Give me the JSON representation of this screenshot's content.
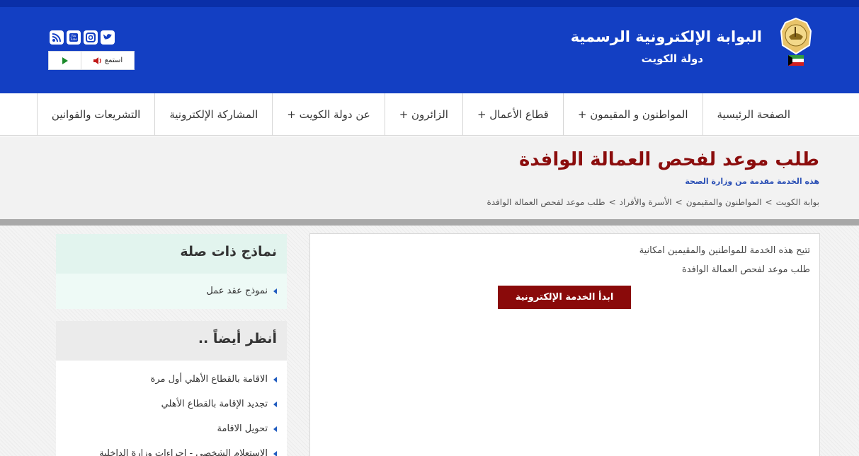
{
  "header": {
    "title": "البوابة الإلكترونية الرسمية",
    "subtitle": "دولة الكويت",
    "listen_label": "استمع",
    "social": [
      "rss-icon",
      "youtube-icon",
      "instagram-icon",
      "twitter-icon"
    ]
  },
  "nav": {
    "items": [
      {
        "label": "الصفحة الرئيسية"
      },
      {
        "label": "المواطنون و المقيمون +"
      },
      {
        "label": "قطاع الأعمال +"
      },
      {
        "label": "الزائرون +"
      },
      {
        "label": "عن دولة الكويت +"
      },
      {
        "label": "المشاركة الإلكترونية"
      },
      {
        "label": "التشريعات والقوانين"
      }
    ]
  },
  "page": {
    "title": "طلب موعد لفحص العمالة الوافدة",
    "provider": "هذه الخدمة مقدمة من وزارة الصحة",
    "breadcrumb": [
      "بوابة الكويت",
      ">",
      "المواطنون والمقيمون",
      ">",
      "الأسرة والأفراد",
      ">",
      "طلب موعد لفحص العمالة الوافدة"
    ]
  },
  "main": {
    "desc_line1": "تتيح هذه الخدمة للمواطنين والمقيمين امكانية",
    "desc_line2": "طلب موعد لفحص العمالة الوافدة",
    "start_button": "ابدأ الخدمة الإلكترونية"
  },
  "sidebar": {
    "related_forms": {
      "title": "نماذج ذات صلة",
      "items": [
        "نموذج عقد عمل"
      ]
    },
    "see_also": {
      "title": "أنظر أيضاً ..",
      "items": [
        "الاقامة بالقطاع الأهلي أول مرة",
        "تجديد الإقامة بالقطاع الأهلي",
        "تحويل الاقامة",
        "الاستعلام الشخصي - إجراءات وزارة الداخلية"
      ]
    }
  },
  "colors": {
    "header_blue": "#133fc3",
    "title_red": "#8b0d0d",
    "button_red": "#8a0a0a",
    "provider_blue": "#2a4fb5"
  }
}
